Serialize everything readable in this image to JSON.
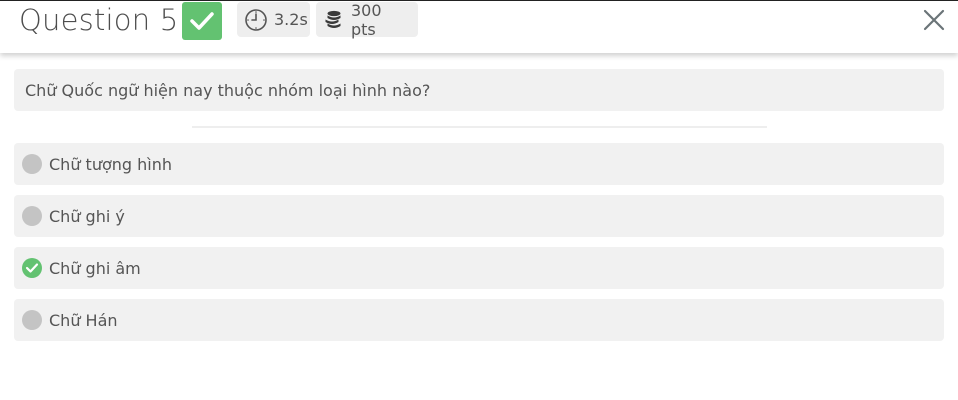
{
  "header": {
    "title": "Question 5",
    "status": "correct",
    "time": "3.2s",
    "points": "300 pts"
  },
  "question": {
    "text": "Chữ Quốc ngữ hiện nay thuộc nhóm loại hình nào?"
  },
  "options": [
    {
      "label": "Chữ tượng hình",
      "state": "unselected"
    },
    {
      "label": "Chữ ghi ý",
      "state": "unselected"
    },
    {
      "label": "Chữ ghi âm",
      "state": "correct"
    },
    {
      "label": "Chữ Hán",
      "state": "unselected"
    }
  ],
  "colors": {
    "correct_green": "#63c271",
    "neutral_marker": "#c4c4c4",
    "card_bg": "#f1f1f1",
    "text": "#555555"
  },
  "icons": {
    "badge": "checkmark-icon",
    "time": "clock-icon",
    "points": "coins-icon",
    "close": "close-icon"
  }
}
